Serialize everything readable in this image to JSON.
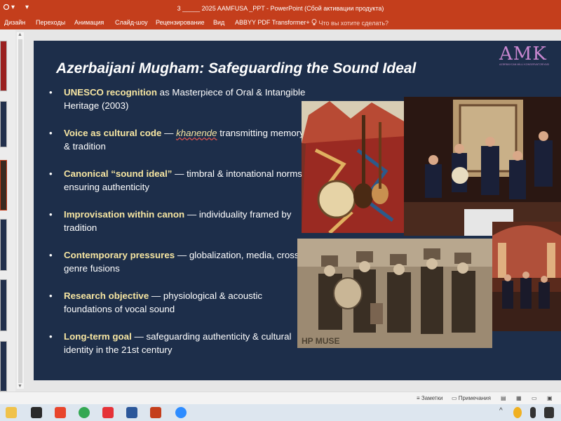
{
  "window": {
    "title": "3 _____ 2025 AAMFUSA _PPT - PowerPoint (Сбой активации продукта)"
  },
  "ribbon": {
    "tabs": [
      "Дизайн",
      "Переходы",
      "Анимация",
      "Слайд-шоу",
      "Рецензирование",
      "Вид",
      "ABBYY PDF Transformer+"
    ],
    "tell_me": "Что вы хотите сделать?"
  },
  "slide": {
    "title": "Azerbaijani Mugham: Safeguarding the Sound Ideal",
    "logo_text": "AMK",
    "logo_subtext": "AZƏRBAYCAN MİLLİ KONSERVATORİYASI",
    "bullets": [
      {
        "head": "UNESCO recognition",
        "text": " as Masterpiece of Oral & Intangible Heritage (2003)"
      },
      {
        "head": "Voice as cultural code",
        "pre": " — ",
        "term": "khanende",
        "text": " transmitting memory & tradition"
      },
      {
        "head": "Canonical “sound ideal”",
        "text": " — timbral & intonational norms ensuring authenticity"
      },
      {
        "head": "Improvisation within canon",
        "text": " — individuality framed by tradition"
      },
      {
        "head": "Contemporary pressures",
        "text": " — globalization, media, cross-genre fusions"
      },
      {
        "head": "Research objective",
        "text": " — physiological & acoustic foundations of vocal sound"
      },
      {
        "head": "Long-term goal",
        "text": " — safeguarding authenticity & cultural identity in the 21st century"
      }
    ],
    "photo_watermark": "HP MUSE"
  },
  "statusbar": {
    "notes": "Заметки",
    "comments": "Примечания"
  },
  "colors": {
    "accent": "#c43e1c",
    "slide_bg": "#1d2e4a",
    "bullet_head": "#f7e6a2"
  }
}
